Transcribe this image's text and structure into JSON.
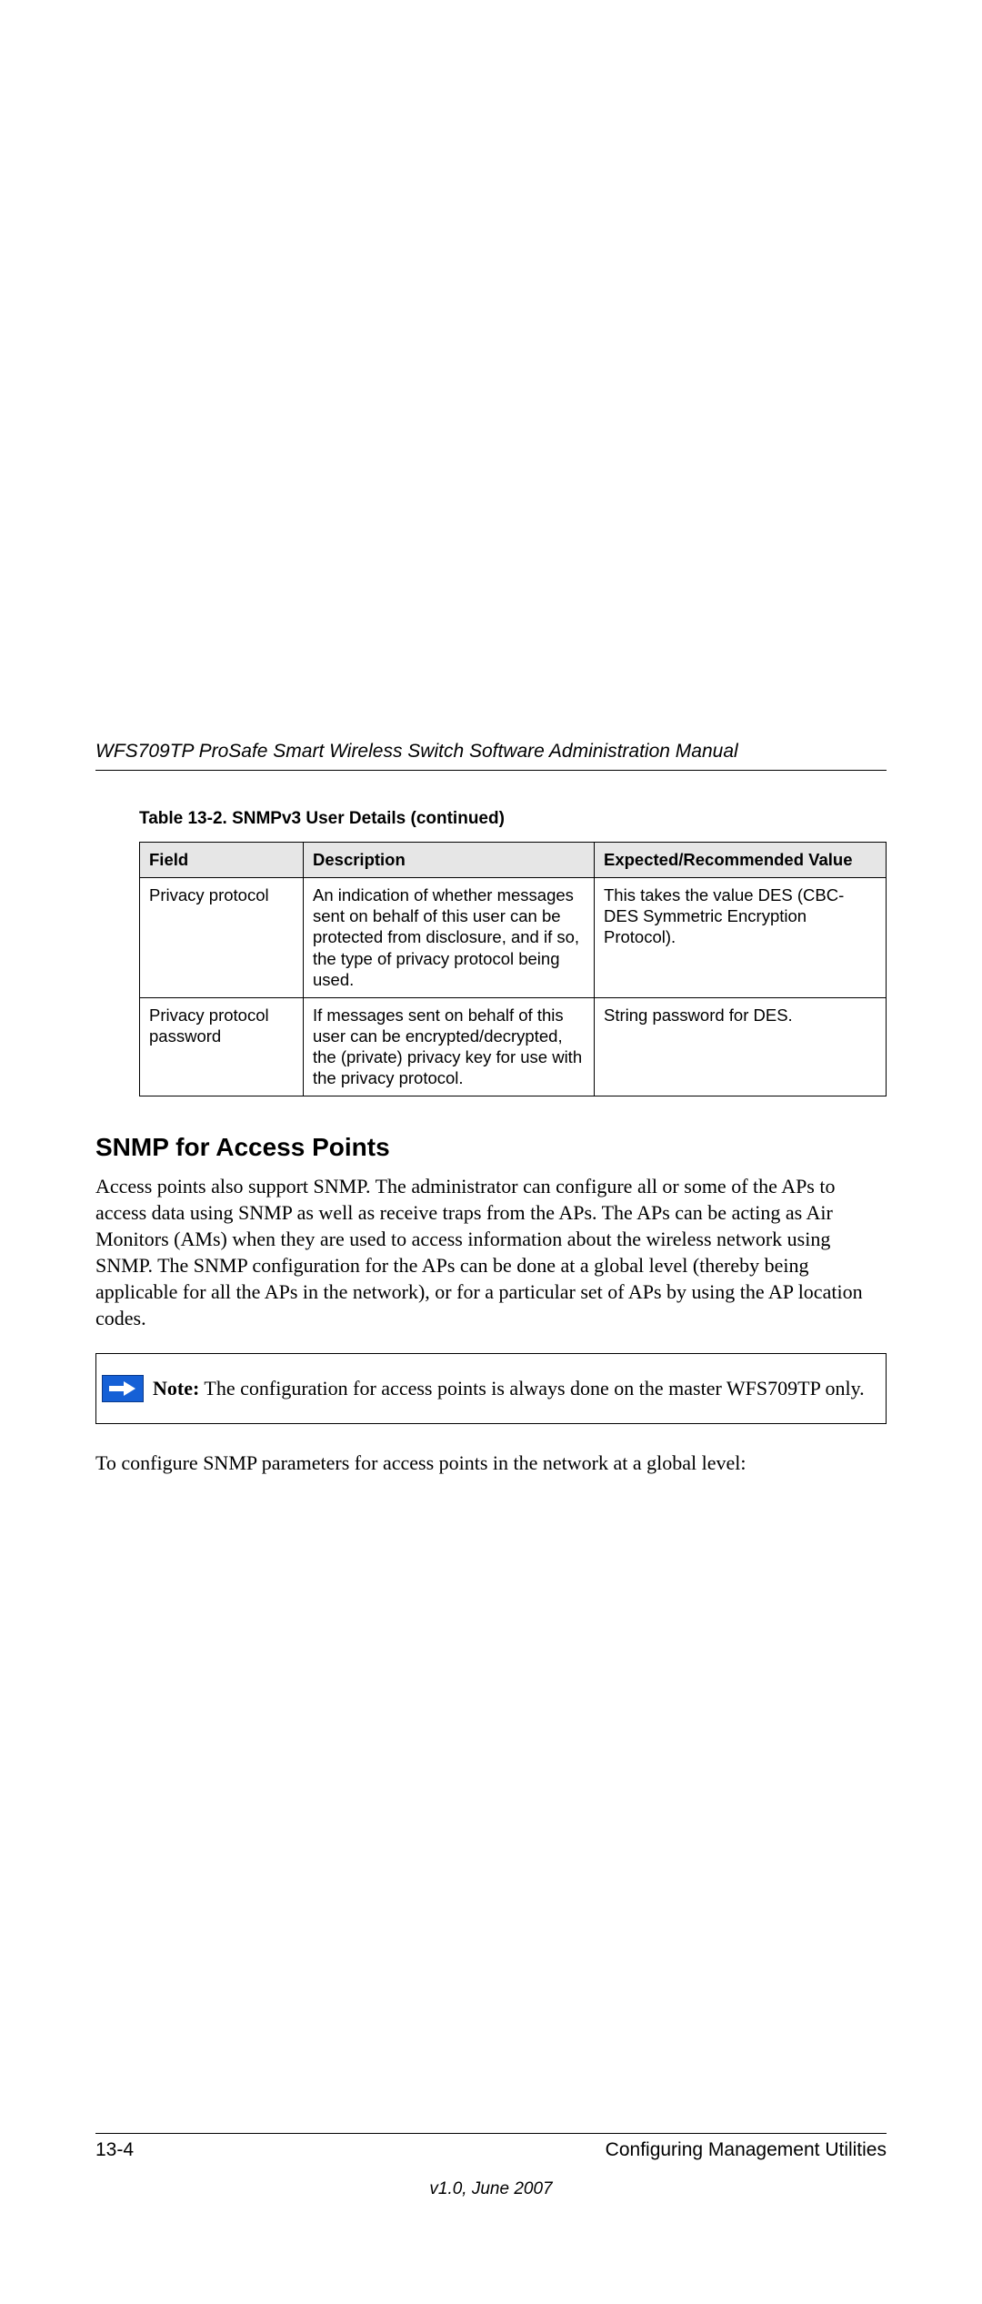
{
  "doc_title": "WFS709TP ProSafe Smart Wireless Switch Software Administration Manual",
  "table": {
    "caption": "Table 13-2. SNMPv3 User Details (continued)",
    "headers": [
      "Field",
      "Description",
      "Expected/Recommended Value"
    ],
    "rows": [
      {
        "field": "Privacy protocol",
        "description": "An indication of whether messages sent on behalf of this user can be protected from disclosure, and if so, the type of privacy protocol being used.",
        "expected": "This takes the value DES (CBC-DES Symmetric Encryption Protocol)."
      },
      {
        "field": "Privacy protocol password",
        "description": "If messages sent on behalf of this user can be encrypted/decrypted, the (private) privacy key for use with the privacy protocol.",
        "expected": "String password for DES."
      }
    ]
  },
  "section_heading": "SNMP for Access Points",
  "body_para": "Access points also support SNMP. The administrator can configure all or some of the APs to access data using SNMP as well as receive traps from the APs. The APs can be acting as Air Monitors (AMs) when they are used to access information about the wireless network using SNMP. The SNMP configuration for the APs can be done at a global level (thereby being applicable for all the APs in the network), or for a particular set of APs by using the AP location codes.",
  "note": {
    "label": "Note:",
    "text": " The configuration for access points is always done on the master WFS709TP only."
  },
  "lead_in": "To configure SNMP parameters for access points in the network at a global level:",
  "footer": {
    "page": "13-4",
    "chapter": "Configuring Management Utilities",
    "version": "v1.0, June 2007"
  }
}
